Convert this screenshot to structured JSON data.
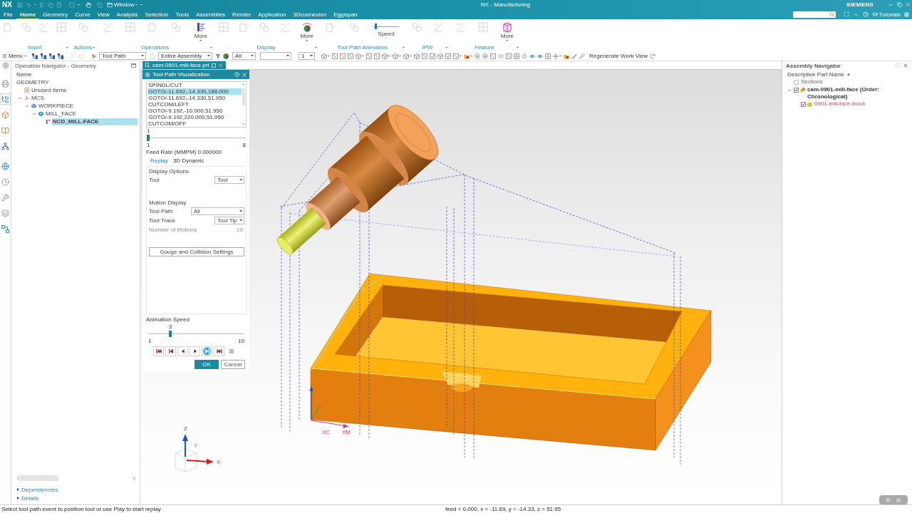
{
  "title_bar": {
    "logo": "NX",
    "window_menu": "Window",
    "title": "NX - Manufacturing",
    "brand": "SIEMENS"
  },
  "menu_tabs": [
    {
      "label": "File",
      "selected": false
    },
    {
      "label": "Home",
      "selected": true
    },
    {
      "label": "Geometry",
      "selected": false
    },
    {
      "label": "Curve",
      "selected": false
    },
    {
      "label": "View",
      "selected": false
    },
    {
      "label": "Analysis",
      "selected": false
    },
    {
      "label": "Selection",
      "selected": false
    },
    {
      "label": "Tools",
      "selected": false
    },
    {
      "label": "Assemblies",
      "selected": false
    },
    {
      "label": "Render",
      "selected": false
    },
    {
      "label": "Application",
      "selected": false
    },
    {
      "label": "3Dconnexion",
      "selected": false
    },
    {
      "label": "Eggispan",
      "selected": false
    }
  ],
  "top_right": {
    "tutorials": "Tutorials"
  },
  "ribbon": {
    "groups": [
      {
        "label": "Insert"
      },
      {
        "label": "Actions"
      },
      {
        "label": "Operations",
        "more": {
          "label": "More",
          "kind": "bars"
        }
      },
      {
        "label": "Display",
        "more": {
          "label": "More",
          "kind": "pie"
        }
      },
      {
        "label": "Tool Path Animation",
        "speed": {
          "label": "Speed",
          "level": 0.05
        }
      },
      {
        "label": "IPW"
      },
      {
        "label": "Feature",
        "more": {
          "label": "More",
          "kind": "box"
        }
      }
    ]
  },
  "toolbar": {
    "menu": "Menu",
    "dropdowns": [
      {
        "value": "Tool Path"
      },
      {
        "value": "Entire Assembly"
      },
      {
        "value": "All"
      },
      {
        "value": "1"
      }
    ],
    "regenerate": "Regenerate Work View"
  },
  "resource_bar": [
    {
      "kind": "machine",
      "selected": false
    },
    {
      "kind": "operations",
      "selected": true
    },
    {
      "kind": "tool",
      "selected": false
    },
    {
      "kind": "library",
      "selected": false
    },
    {
      "kind": "program",
      "selected": false
    },
    {
      "kind": "web",
      "selected": false
    },
    {
      "kind": "history",
      "selected": false
    },
    {
      "kind": "tools",
      "selected": false
    },
    {
      "kind": "reuse",
      "selected": false
    },
    {
      "kind": "connections",
      "selected": false
    }
  ],
  "operation_navigator": {
    "title": "Operation Navigator - Geometry",
    "column": "Name",
    "tree": [
      {
        "label": "GEOMETRY",
        "selected": false,
        "children": [
          {
            "label": "Unused Items",
            "kind": "folder",
            "selected": false
          },
          {
            "label": "MCS",
            "kind": "mcs",
            "selected": false,
            "expanded": true,
            "children": [
              {
                "label": "WORKPIECE",
                "kind": "workpiece",
                "selected": false,
                "expanded": true,
                "children": [
                  {
                    "label": "MILL_FACE",
                    "kind": "feature",
                    "selected": false,
                    "expanded": true,
                    "children": [
                      {
                        "label": "NCD_MILL-FACE",
                        "kind": "operation",
                        "selected": true
                      }
                    ]
                  }
                ]
              }
            ]
          }
        ]
      }
    ],
    "sections": [
      {
        "label": "Dependencies",
        "expanded": false
      },
      {
        "label": "Details",
        "expanded": false
      }
    ]
  },
  "document_tab": {
    "label": "cam-0901-mill-face.prt"
  },
  "dialog": {
    "title": "Tool Path Visualization",
    "events": [
      {
        "text": "SPINDL/CUT",
        "selected": false
      },
      {
        "text": "GOTO/-11.692,-14.330,188.000",
        "selected": true
      },
      {
        "text": "GOTO/-11.692,-14.330,51.950",
        "selected": false
      },
      {
        "text": "CUTCOM/LEFT",
        "selected": false
      },
      {
        "text": "GOTO/-9.192,-10.000,51.950",
        "selected": false
      },
      {
        "text": "GOTO/-9.192,220.000,51.950",
        "selected": false
      },
      {
        "text": "CUTCOM/OFF",
        "selected": false
      }
    ],
    "event_slider": {
      "value": "1",
      "min": "1",
      "max": "8",
      "level": 0
    },
    "feed_rate": "Feed Rate (MMPM) 0.000000",
    "tabs": [
      {
        "label": "Replay",
        "selected": true
      },
      {
        "label": "3D Dynamic",
        "selected": false
      }
    ],
    "display_options": {
      "heading": "Display Options",
      "rows": [
        {
          "kind": "dropdown",
          "label": "Tool",
          "value": "Tool",
          "disabled": false
        }
      ]
    },
    "motion_display": {
      "heading": "Motion Display",
      "rows": [
        {
          "kind": "dropdown",
          "label": "Tool Path",
          "value": "All",
          "disabled": false
        },
        {
          "kind": "dropdown",
          "label": "Tool Trace",
          "value": "Tool Tip",
          "disabled": false
        },
        {
          "kind": "number",
          "label": "Number of Motions",
          "value": "10",
          "disabled": true
        }
      ]
    },
    "gouge_button": "Gouge and Collision Settings",
    "animation_speed": {
      "label": "Animation Speed",
      "value": "3",
      "min": "1",
      "max": "10",
      "level": 0.22
    },
    "playback": [
      {
        "kind": "first",
        "highlighted": false,
        "disabled": false
      },
      {
        "kind": "step_back",
        "highlighted": false,
        "disabled": false
      },
      {
        "kind": "reverse",
        "highlighted": false,
        "disabled": false
      },
      {
        "kind": "play",
        "highlighted": false,
        "disabled": false
      },
      {
        "kind": "step_forward",
        "highlighted": true,
        "disabled": false
      },
      {
        "kind": "last",
        "highlighted": false,
        "disabled": false
      },
      {
        "kind": "stop",
        "highlighted": false,
        "disabled": true
      }
    ],
    "buttons": [
      {
        "label": "OK",
        "kind": "primary"
      },
      {
        "label": "Cancel",
        "kind": "secondary"
      }
    ]
  },
  "viewport": {
    "axis_labels": [
      "XC",
      "XM"
    ],
    "triad_labels": [
      "Z",
      "Y",
      "X"
    ]
  },
  "assembly_navigator": {
    "title": "Assembly Navigator",
    "column": "Descriptive Part Name",
    "tree": [
      {
        "label": "Sections",
        "kind": "sections"
      },
      {
        "label": "cam-0901-mill-face (Order: Chronological)",
        "kind": "assembly",
        "checked": true,
        "expanded": true,
        "children": [
          {
            "label": "0901-mill-face-block",
            "kind": "part",
            "checked": true
          }
        ]
      }
    ]
  },
  "status_bar": {
    "prompt": "Select tool path event to position tool or use Play to start replay",
    "readout": "feed = 0.000, x = -11.69, y = -14.33, z = 51.95"
  }
}
